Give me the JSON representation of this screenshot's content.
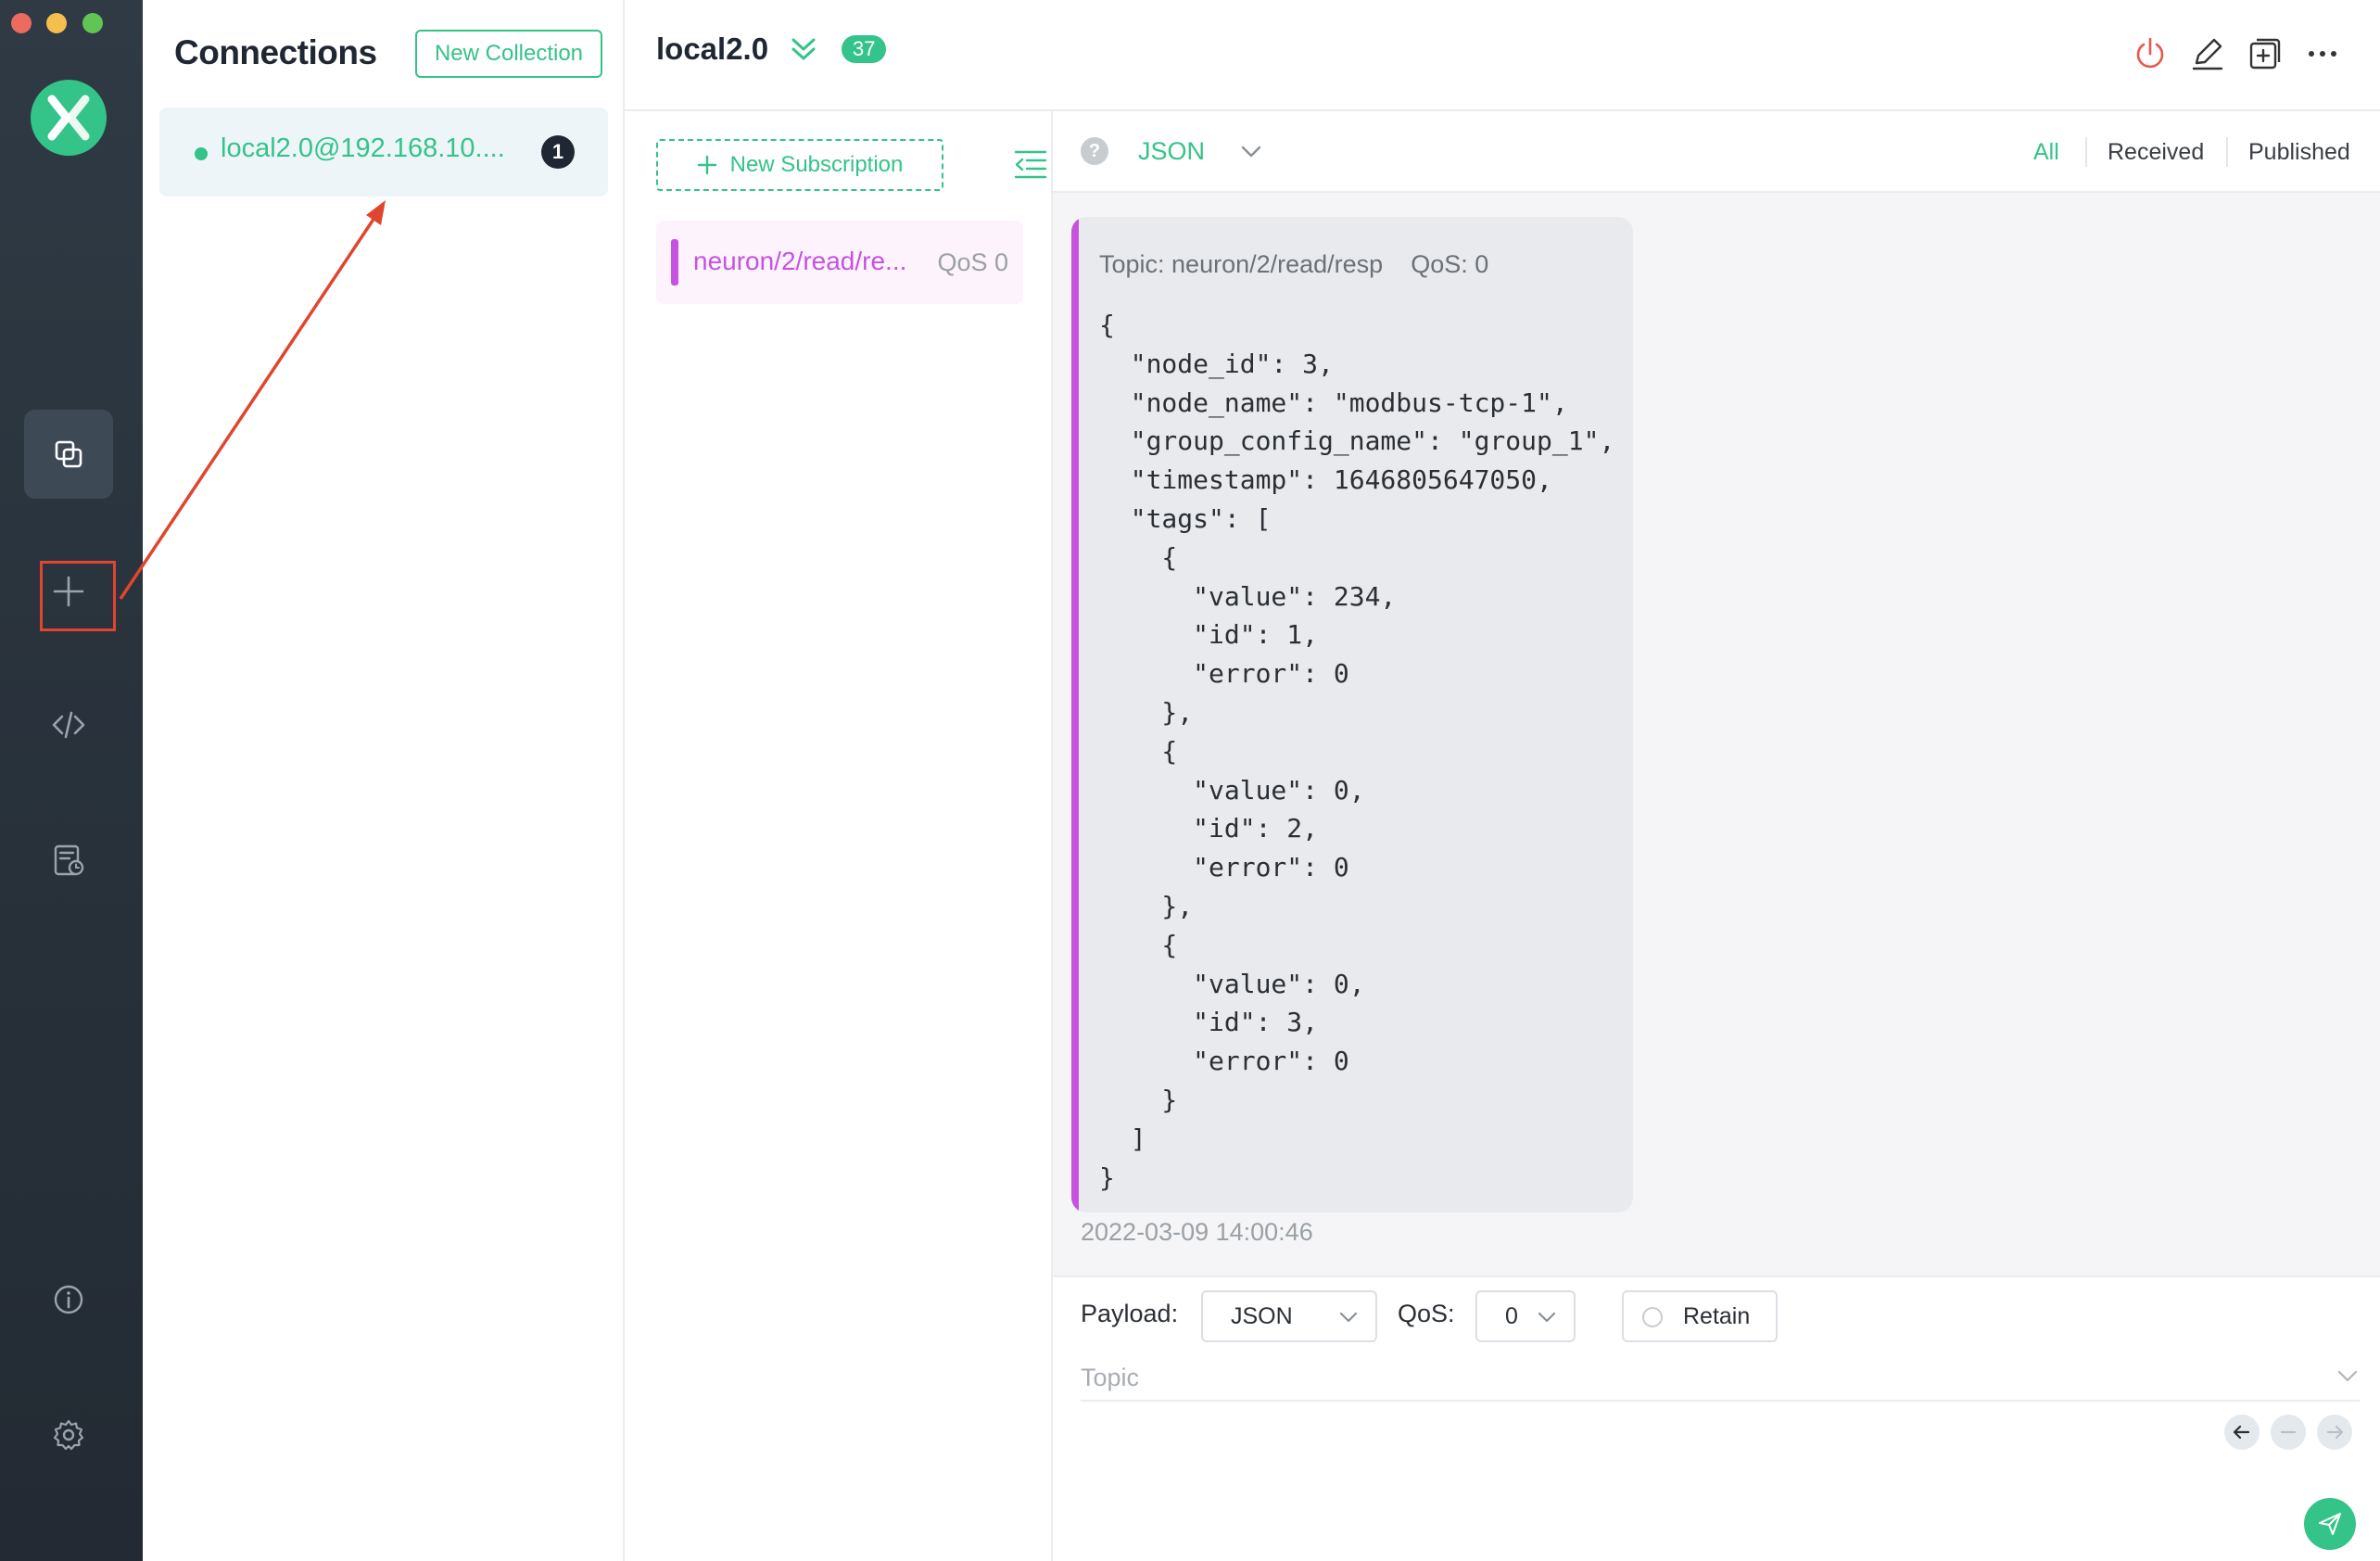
{
  "sidebar": {
    "icons": [
      "connections-icon",
      "add-connection-icon",
      "script-icon",
      "log-icon",
      "about-icon",
      "settings-icon"
    ]
  },
  "connections": {
    "title": "Connections",
    "new_collection_label": "New Collection",
    "items": [
      {
        "label": "local2.0@192.168.10....",
        "unread": "1",
        "status": "connected"
      }
    ]
  },
  "header": {
    "title": "local2.0",
    "message_count": "37"
  },
  "subscriptions": {
    "new_label": "New Subscription",
    "items": [
      {
        "topic": "neuron/2/read/re...",
        "qos": "QoS 0",
        "color": "#c653e0"
      }
    ]
  },
  "messages": {
    "format": "JSON",
    "filters": [
      "All",
      "Received",
      "Published"
    ],
    "active_filter": "All",
    "items": [
      {
        "topic_line": "Topic: neuron/2/read/resp",
        "qos_line": "QoS: 0",
        "payload": "{\n  \"node_id\": 3,\n  \"node_name\": \"modbus-tcp-1\",\n  \"group_config_name\": \"group_1\",\n  \"timestamp\": 1646805647050,\n  \"tags\": [\n    {\n      \"value\": 234,\n      \"id\": 1,\n      \"error\": 0\n    },\n    {\n      \"value\": 0,\n      \"id\": 2,\n      \"error\": 0\n    },\n    {\n      \"value\": 0,\n      \"id\": 3,\n      \"error\": 0\n    }\n  ]\n}",
        "time": "2022-03-09 14:00:46"
      }
    ]
  },
  "publish": {
    "payload_label": "Payload:",
    "payload_format": "JSON",
    "qos_label": "QoS:",
    "qos_value": "0",
    "retain_label": "Retain",
    "topic_placeholder": "Topic"
  },
  "colors": {
    "accent": "#34c388",
    "subscription": "#c653e0",
    "annotation": "#e0452f"
  }
}
